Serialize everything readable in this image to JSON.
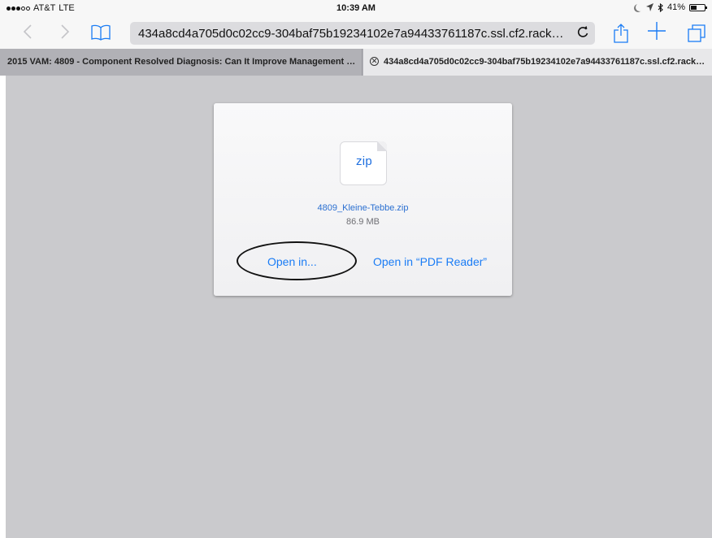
{
  "status_bar": {
    "carrier": "AT&T",
    "network": "LTE",
    "time": "10:39 AM",
    "battery": "41%"
  },
  "toolbar": {
    "back_icon": "chevron-left-icon",
    "forward_icon": "chevron-right-icon",
    "bookmarks_icon": "book-icon",
    "address": "434a8cd4a705d0c02cc9-304baf75b19234102e7a94433761187c.ssl.cf2.rackcdn.com",
    "reload_icon": "reload-icon",
    "share_icon": "share-icon",
    "new_tab_icon": "plus-icon",
    "tabs_icon": "tabs-icon"
  },
  "tabs": [
    {
      "title": "2015 VAM: 4809 - Component Resolved Diagnosis: Can It Improve Management of Y..."
    },
    {
      "title": "434a8cd4a705d0c02cc9-304baf75b19234102e7a94433761187c.ssl.cf2.rackcdn.c..."
    }
  ],
  "download": {
    "file_type": "zip",
    "file_name": "4809_Kleine-Tebbe.zip",
    "file_size": "86.9 MB",
    "open_in_label": "Open in...",
    "open_in_app_label": "Open in “PDF Reader”"
  },
  "colors": {
    "accent": "#1a7cf5",
    "content_background": "#cacacd",
    "tab_strip": "#b4b4b9"
  }
}
